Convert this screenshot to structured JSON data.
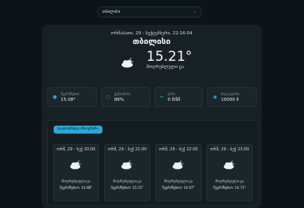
{
  "header": {
    "city_select": {
      "value": "თბილისი"
    }
  },
  "current": {
    "datetime": "ორშაბათი, 29 - სექტემბერი, 22:16:04",
    "city": "თბილისი",
    "temperature": "15.21°",
    "condition": "მოღრუბლული ცა",
    "icon": "cloud-moon-icon"
  },
  "stats": [
    {
      "label": "შეგრძნებით",
      "value": "15.08°",
      "icon": "thermometer-icon"
    },
    {
      "label": "ტენიანობა",
      "value": "88%",
      "icon": "humidity-icon"
    },
    {
      "label": "ქარი",
      "value": "0 მ/წმ",
      "icon": "wind-icon"
    },
    {
      "label": "ხილვადობა",
      "value": "10000 მ",
      "icon": "eye-icon"
    }
  ],
  "forecast": {
    "button_label": "საათობრივი პროგნოზი",
    "cards": [
      {
        "time": "ორშ, 29 - სექ 20:00",
        "condition": "მოღრუბლული ცა",
        "feels": "შეგრძნებით: 14.88°"
      },
      {
        "time": "ორშ, 29 - სექ 21:00",
        "condition": "მოღრუბლული ცა",
        "feels": "შეგრძნებით: 15.31°"
      },
      {
        "time": "ორშ, 29 - სექ 22:00",
        "condition": "მოღრუბლული ცა",
        "feels": "შეგრძნებით: 14.97°"
      },
      {
        "time": "ორშ, 29 - სექ 23:00",
        "condition": "მოღრუბლული ცა",
        "feels": "შეგრძნებით: 14.71°"
      }
    ]
  },
  "colors": {
    "accent": "#27a9d6",
    "background": "#0d1417",
    "card": "#172125"
  }
}
